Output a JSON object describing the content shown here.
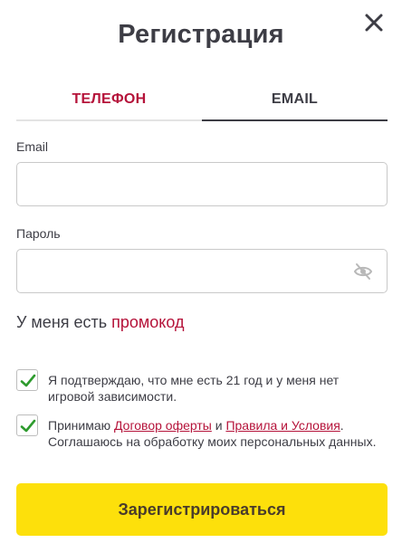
{
  "dialog": {
    "title": "Регистрация",
    "close_icon": "close-icon"
  },
  "tabs": [
    {
      "label": "ТЕЛЕФОН",
      "active": false
    },
    {
      "label": "EMAIL",
      "active": true
    }
  ],
  "form": {
    "email": {
      "label": "Email",
      "value": "",
      "placeholder": ""
    },
    "password": {
      "label": "Пароль",
      "value": "",
      "placeholder": "",
      "toggle_icon": "eye-slash-icon"
    }
  },
  "promo": {
    "prefix": "У меня есть ",
    "link": "промокод"
  },
  "consents": [
    {
      "checked": true,
      "text": "Я подтверждаю, что мне есть 21 год и у меня нет игровой зависимости."
    },
    {
      "checked": true,
      "text_before": "Принимаю ",
      "link1": "Договор оферты",
      "text_middle": " и ",
      "link2": "Правила и Условия",
      "text_after": ". Соглашаюсь на обработку моих персональных данных."
    }
  ],
  "submit_label": "Зарегистрироваться",
  "colors": {
    "accent": "#b5133a",
    "button": "#fde00b",
    "checkmark": "#2e9b2e",
    "text": "#3d3d45"
  }
}
